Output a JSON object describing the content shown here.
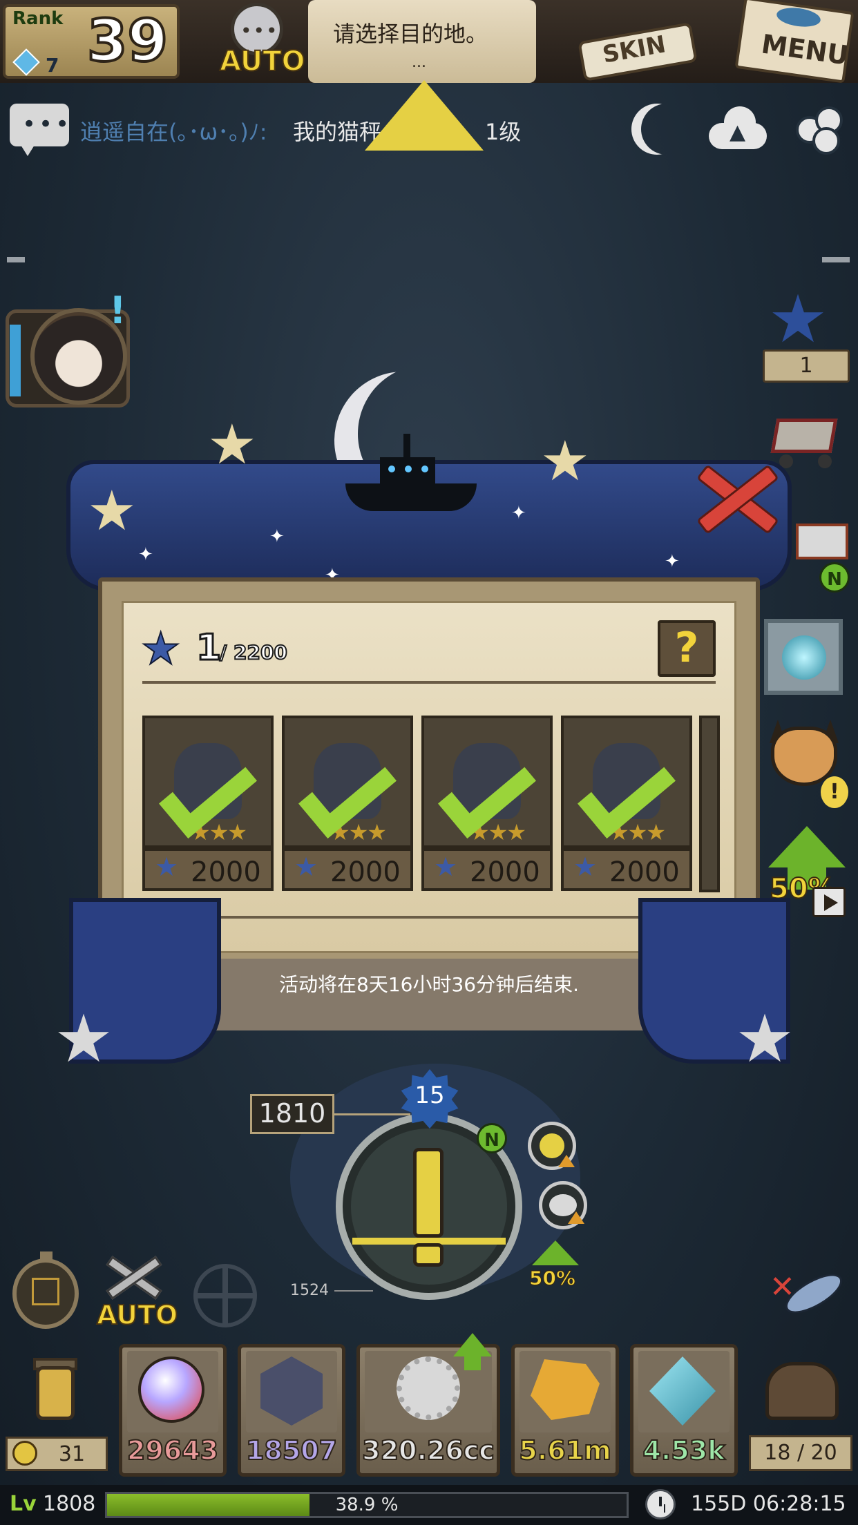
{
  "top_bar": {
    "rank_label": "Rank",
    "rank_value": "39",
    "rank_sub_value": "7",
    "auto_label": "AUTO",
    "destination_prompt": "请选择目的地。",
    "destination_more": "...",
    "skin_label": "SKIN",
    "menu_label": "MENU"
  },
  "chat": {
    "sender": "逍遥自在(｡･ω･｡)ﾉ:",
    "message": "我的猫秤",
    "message_suffix": "1级"
  },
  "sidebar": {
    "star_count": "1"
  },
  "badges": {
    "new_label": "N",
    "alert_label": "!"
  },
  "boost": {
    "percent_label": "50%"
  },
  "event": {
    "current": "1",
    "total": "/ 2200",
    "help_label": "?",
    "rewards": [
      {
        "cost": "2000",
        "claimed": true
      },
      {
        "cost": "2000",
        "claimed": true
      },
      {
        "cost": "2000",
        "claimed": true
      },
      {
        "cost": "2000",
        "claimed": true
      }
    ],
    "timer_text": "活动将在8天16小时36分钟后结束."
  },
  "dungeon": {
    "depth_value": "1810",
    "level_value": "15",
    "lower_depth": "1524",
    "boost_label": "50%"
  },
  "bottom_controls": {
    "auto_label": "AUTO"
  },
  "resources": {
    "gold": "31",
    "orbs": "29643",
    "essence": "18507",
    "gears": "320.26cc",
    "ore": "5.61m",
    "crystals": "4.53k",
    "inventory": "18 / 20"
  },
  "status_bar": {
    "level_prefix": "Lv",
    "level": "1808",
    "xp_percent_label": "38.9 %",
    "xp_fraction": 0.389,
    "play_time": "155D 06:28:15"
  },
  "colors": {
    "accent_yellow": "#e5d044",
    "boost_green": "#6cb32b",
    "event_blue": "#2a3f82",
    "xp_green": "#8bbd2a"
  },
  "icons": {
    "chat": "chat-bubble-icon",
    "night": "moon-icon",
    "upload": "cloud-upload-icon",
    "social": "bubbles-icon",
    "close": "close-x-icon",
    "help": "question-icon",
    "clock": "clock-icon"
  }
}
